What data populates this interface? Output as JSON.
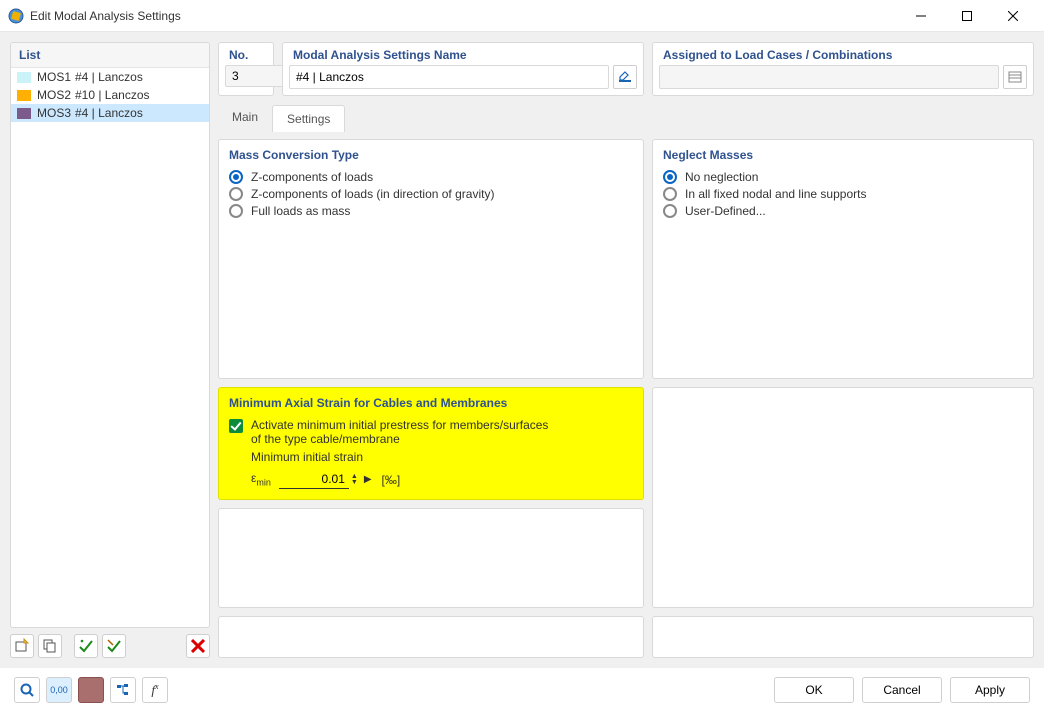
{
  "window": {
    "title": "Edit Modal Analysis Settings"
  },
  "list": {
    "header": "List",
    "items": [
      {
        "id": "MOS1",
        "name": "#4 | Lanczos",
        "color": "#c9f3f6"
      },
      {
        "id": "MOS2",
        "name": "#10 | Lanczos",
        "color": "#ffb000"
      },
      {
        "id": "MOS3",
        "name": "#4 | Lanczos",
        "color": "#7b5b8b",
        "selected": true
      }
    ]
  },
  "fields": {
    "no_label": "No.",
    "no_value": "3",
    "name_label": "Modal Analysis Settings Name",
    "name_value": "#4 | Lanczos",
    "assigned_label": "Assigned to Load Cases / Combinations",
    "assigned_value": ""
  },
  "tabs": {
    "main": "Main",
    "settings": "Settings"
  },
  "mass": {
    "heading": "Mass Conversion Type",
    "opt1": "Z-components of loads",
    "opt2": "Z-components of loads (in direction of gravity)",
    "opt3": "Full loads as mass"
  },
  "neglect": {
    "heading": "Neglect Masses",
    "opt1": "No neglection",
    "opt2": "In all fixed nodal and line supports",
    "opt3": "User-Defined..."
  },
  "strain": {
    "heading": "Minimum Axial Strain for Cables and Membranes",
    "check_label": "Activate minimum initial prestress for members/surfaces of the type cable/membrane",
    "sub_label": "Minimum initial strain",
    "symbol": "ε",
    "symbol_sub": "min",
    "value": "0.01",
    "unit": "[‰]"
  },
  "buttons": {
    "ok": "OK",
    "cancel": "Cancel",
    "apply": "Apply"
  }
}
